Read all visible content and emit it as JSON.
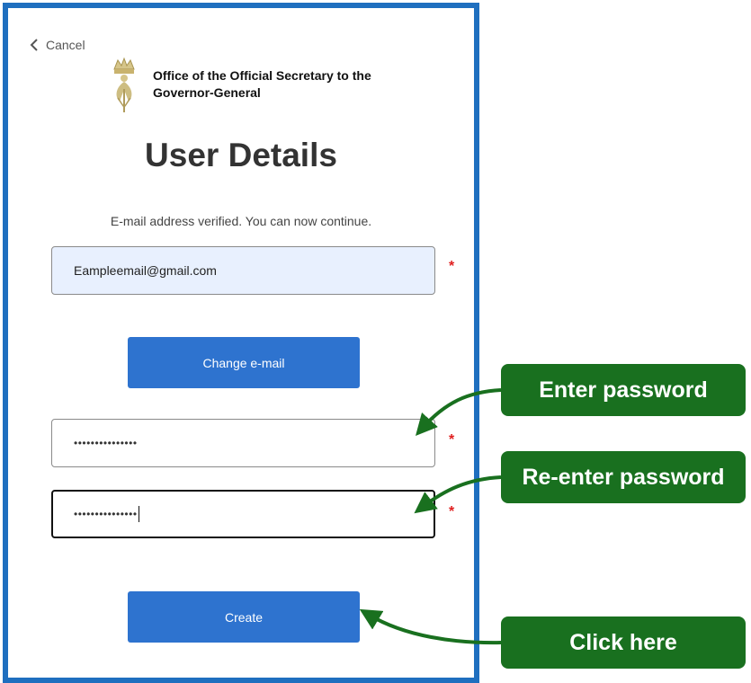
{
  "header": {
    "cancel_label": "Cancel",
    "org_name": "Office of the Official Secretary to the Governor-General",
    "crest_icon": "royal-crest-icon"
  },
  "form": {
    "title": "User Details",
    "verified_message": "E-mail address verified. You can now continue.",
    "email_value": "Eampleemail@gmail.com",
    "change_email_label": "Change e-mail",
    "password_value": "•••••••••••••••",
    "reenter_password_value": "•••••••••••••••",
    "required_marker": "*",
    "create_label": "Create"
  },
  "annotations": {
    "enter_password": "Enter password",
    "reenter_password": "Re-enter password",
    "click_here": "Click here",
    "color": "#19701f"
  },
  "colors": {
    "border": "#1f6fbf",
    "button": "#2e73cf",
    "email_bg": "#e8f0fe",
    "required": "#e02020"
  }
}
